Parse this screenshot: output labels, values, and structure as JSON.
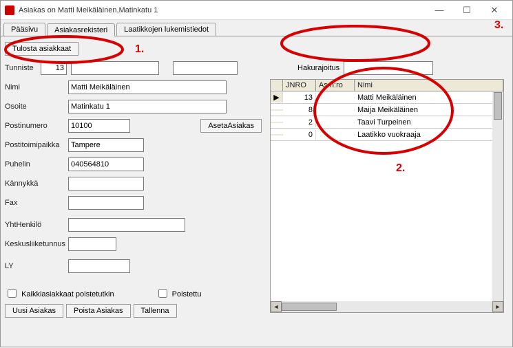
{
  "window": {
    "title": "Asiakas on Matti Meikäläinen,Matinkatu 1"
  },
  "tabs": [
    {
      "label": "Pääsivu"
    },
    {
      "label": "Asiakasrekisteri"
    },
    {
      "label": "Laatikkojen lukemistiedot"
    }
  ],
  "left": {
    "print_btn": "Tulosta asiakkaat",
    "labels": {
      "tunniste": "Tunniste",
      "nimi": "Nimi",
      "osoite": "Osoite",
      "postinumero": "Postinumero",
      "postitoimipaikka": "Postitoimipaikka",
      "puhelin": "Puhelin",
      "kannykka": "Kännykkä",
      "fax": "Fax",
      "yhthenkilo": "YhtHenkilö",
      "keskusliiketunnus": "Keskusliiketunnus",
      "ly": "LY",
      "aseta_btn": "AsetaAsiakas",
      "chk_poistettukin": "Kaikkiasiakkaat poistetutkin",
      "chk_poistettu": "Poistettu",
      "uusi_btn": "Uusi Asiakas",
      "poista_btn": "Poista Asiakas",
      "tallenna_btn": "Tallenna"
    },
    "values": {
      "tunniste": "13",
      "nimi": "Matti Meikäläinen",
      "osoite": "Matinkatu 1",
      "postinumero": "10100",
      "postitoimipaikka": "Tampere",
      "puhelin": "040564810",
      "kannykka": "",
      "fax": "",
      "yhthenkilo": "",
      "keskusliiketunnus": "",
      "ly": ""
    }
  },
  "right": {
    "search_label": "Hakurajoitus",
    "headers": {
      "jnro": "JNRO",
      "asnro": "As n:ro",
      "nimi": "Nimi"
    },
    "rows": [
      {
        "jnro": "13",
        "asnro": "",
        "nimi": "Matti Meikäläinen",
        "selected": true
      },
      {
        "jnro": "8",
        "asnro": "",
        "nimi": "Maija Meikäläinen"
      },
      {
        "jnro": "2",
        "asnro": "",
        "nimi": "Taavi Turpeinen"
      },
      {
        "jnro": "0",
        "asnro": "",
        "nimi": "Laatikko vuokraaja"
      }
    ]
  },
  "annotations": {
    "n1": "1.",
    "n2": "2.",
    "n3": "3."
  }
}
